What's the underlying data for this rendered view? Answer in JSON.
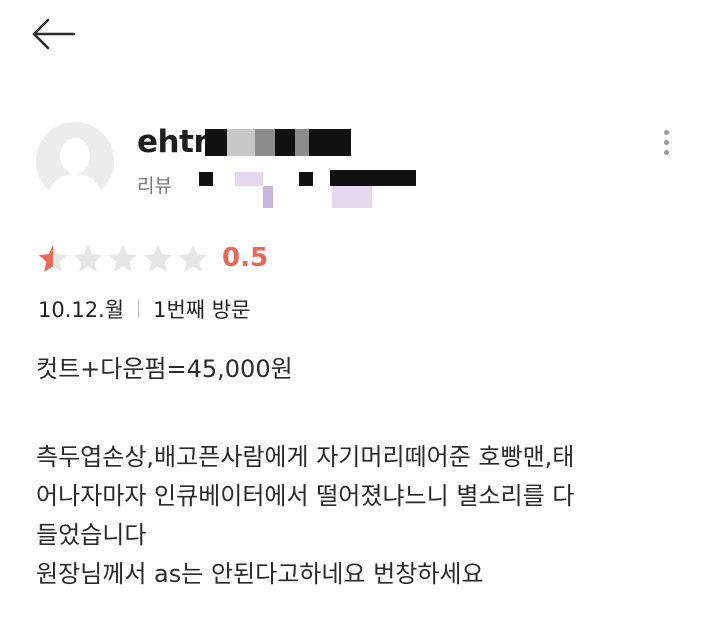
{
  "nav": {
    "back_icon": "arrow-left-icon"
  },
  "author": {
    "username_visible": "ehtn",
    "review_label": "리뷰",
    "avatar_icon": "default-user-avatar-icon",
    "more_icon": "vertical-ellipsis-icon"
  },
  "rating": {
    "score": "0.5",
    "value": 0.5,
    "max": 5,
    "star_color": "#e8695a",
    "empty_star_color": "#e6e6e6"
  },
  "visit": {
    "date": "10.12.월",
    "visit_count": "1번째 방문"
  },
  "review": {
    "line1": "컷트+다운펌=45,000원",
    "paragraph2": "측두엽손상,배고픈사람에게 자기머리떼어준 호빵맨,태\n어나자마자 인큐베이터에서 떨어졌냐느니 별소리를 다\n들었습니다\n원장님께서 as는 안된다고하네요 번창하세요"
  }
}
